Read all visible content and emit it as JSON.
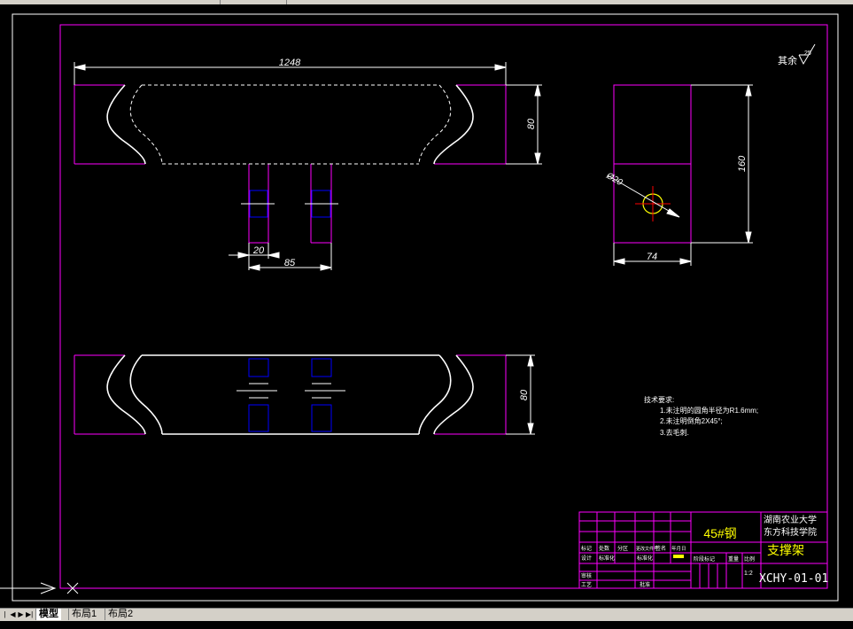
{
  "dimensions": {
    "overall_length": "1248",
    "height_front": "80",
    "height_top": "80",
    "side_height": "160",
    "side_width": "74",
    "hole_diameter": "Ø20",
    "slot_width": "20",
    "slot_spacing": "85"
  },
  "roughness_note": "其余",
  "roughness_symbol": "25",
  "tech_requirements": {
    "title": "技术要求:",
    "items": [
      "1.未注明的圆角半径为R1.6mm;",
      "2.未注明倒角2X45°;",
      "3.去毛刺."
    ]
  },
  "title_block": {
    "material": "45#钢",
    "school_line1": "湖南农业大学",
    "school_line2": "东方科技学院",
    "part_name": "支撑架",
    "drawing_number": "XCHY-01-01",
    "scale": "1:2",
    "labels": {
      "mark": "标记",
      "count": "处数",
      "zone": "分区",
      "change_doc": "更改文件号",
      "signature": "签名",
      "date": "年月日",
      "design": "设计",
      "standardize_l": "标准化",
      "standardize_r": "标准化",
      "stage_mark": "阶段标记",
      "weight": "重量",
      "scale_label": "比例",
      "review": "审核",
      "process": "工艺",
      "approve": "批准"
    }
  },
  "tabs": [
    {
      "label": "模型",
      "active": true
    },
    {
      "label": "布局1",
      "active": false
    },
    {
      "label": "布局2",
      "active": false
    }
  ],
  "colors": {
    "background": "#000000",
    "frame": "#ff00ff",
    "geometry": "#ffffff",
    "hidden": "#0000ff",
    "center": "#ff0000",
    "material_text": "#ffff00"
  }
}
